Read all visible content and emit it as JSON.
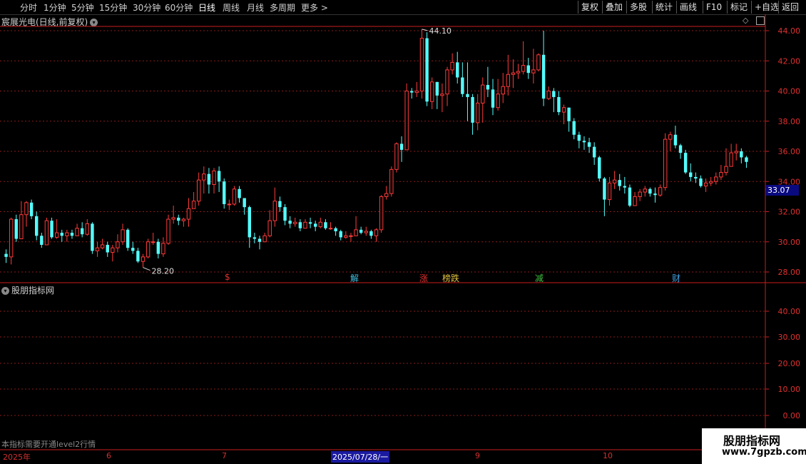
{
  "toolbar": {
    "periods": [
      "分时",
      "1分钟",
      "5分钟",
      "15分钟",
      "30分钟",
      "60分钟",
      "日线",
      "周线",
      "月线",
      "多周期",
      "更多 >"
    ],
    "active_period": "日线",
    "right_buttons": [
      "复权",
      "叠加",
      "多股",
      "统计",
      "画线",
      "F10",
      "标记",
      "+自选",
      "返回"
    ]
  },
  "main_chart": {
    "title": "宸展光电(日线,前复权)",
    "current_price": "33.07",
    "high_label": "44.10",
    "low_label": "28.20",
    "y_ticks": [
      "44.00",
      "42.00",
      "40.00",
      "38.00",
      "36.00",
      "34.00",
      "32.00",
      "30.00",
      "28.00"
    ],
    "events": [
      {
        "text": "$",
        "color": "#e03030"
      },
      {
        "text": "解",
        "color": "#40c0e0"
      },
      {
        "text": "涨",
        "color": "#e03030"
      },
      {
        "text": "榜跌",
        "color": "#e0c040"
      },
      {
        "text": "减",
        "color": "#40c040"
      },
      {
        "text": "财",
        "color": "#40a0e0"
      }
    ]
  },
  "indicator_panel": {
    "title": "股朋指标网",
    "y_ticks": [
      "40.00",
      "30.00",
      "20.00",
      "10.00",
      "0.00"
    ],
    "notice": "本指标需要开通level2行情"
  },
  "date_axis": {
    "labels": [
      "2025年",
      "6",
      "7",
      "2025/07/28/一",
      "9",
      "10"
    ]
  },
  "watermark": {
    "line1": "股朋指标网",
    "line2": "www.7gpzb.com"
  },
  "colors": {
    "up": "#ff3b3b",
    "down": "#54ffff",
    "axis": "#c81e1e",
    "grid": "#8a1a1a"
  },
  "chart_data": {
    "type": "candlestick",
    "ylim": [
      27.5,
      44.5
    ],
    "candles": [
      [
        29.2,
        29.0,
        29.5,
        28.6
      ],
      [
        29.0,
        31.5,
        31.6,
        28.5
      ],
      [
        31.5,
        30.2,
        31.8,
        30.0
      ],
      [
        30.2,
        31.8,
        32.7,
        30.2
      ],
      [
        31.8,
        32.6,
        32.7,
        31.0
      ],
      [
        32.6,
        31.7,
        32.8,
        31.5
      ],
      [
        31.7,
        30.4,
        32.0,
        30.1
      ],
      [
        30.4,
        29.8,
        30.6,
        29.6
      ],
      [
        29.8,
        31.4,
        31.6,
        29.8
      ],
      [
        31.4,
        30.3,
        31.6,
        30.2
      ],
      [
        30.3,
        30.6,
        31.5,
        30.2
      ],
      [
        30.6,
        30.4,
        30.8,
        30.0
      ],
      [
        30.4,
        30.6,
        30.8,
        30.0
      ],
      [
        30.6,
        30.4,
        30.8,
        30.2
      ],
      [
        30.4,
        30.9,
        31.2,
        30.4
      ],
      [
        30.9,
        30.5,
        31.3,
        30.3
      ],
      [
        30.5,
        31.2,
        31.5,
        30.4
      ],
      [
        31.2,
        29.4,
        31.3,
        29.2
      ],
      [
        29.4,
        29.6,
        30.0,
        29.0
      ],
      [
        29.6,
        29.8,
        30.2,
        29.5
      ],
      [
        29.8,
        29.3,
        30.0,
        29.0
      ],
      [
        29.3,
        29.6,
        29.8,
        28.7
      ],
      [
        29.6,
        30.0,
        30.5,
        29.3
      ],
      [
        30.0,
        30.8,
        31.2,
        29.8
      ],
      [
        30.8,
        29.6,
        30.9,
        29.4
      ],
      [
        29.6,
        29.4,
        30.0,
        29.2
      ],
      [
        29.4,
        28.7,
        29.6,
        28.6
      ],
      [
        28.7,
        29.0,
        29.2,
        28.3
      ],
      [
        29.0,
        30.0,
        30.2,
        28.9
      ],
      [
        30.0,
        30.0,
        30.6,
        29.8
      ],
      [
        30.0,
        29.2,
        30.2,
        28.9
      ],
      [
        29.2,
        29.9,
        30.3,
        29.0
      ],
      [
        29.9,
        31.5,
        31.8,
        29.8
      ],
      [
        31.5,
        31.6,
        32.4,
        31.2
      ],
      [
        31.6,
        31.4,
        31.8,
        31.1
      ],
      [
        31.4,
        31.5,
        31.6,
        31.0
      ],
      [
        31.5,
        32.2,
        32.9,
        31.0
      ],
      [
        32.2,
        32.7,
        33.3,
        32.2
      ],
      [
        32.7,
        34.1,
        34.6,
        32.4
      ],
      [
        34.1,
        34.5,
        35.0,
        33.2
      ],
      [
        34.5,
        33.8,
        34.9,
        33.2
      ],
      [
        33.8,
        34.7,
        34.9,
        33.2
      ],
      [
        34.7,
        34.0,
        35.0,
        33.3
      ],
      [
        34.0,
        32.5,
        34.2,
        32.2
      ],
      [
        32.5,
        32.5,
        32.8,
        32.1
      ],
      [
        32.5,
        33.5,
        33.7,
        32.4
      ],
      [
        33.5,
        32.9,
        33.7,
        32.6
      ],
      [
        32.9,
        32.3,
        32.9,
        31.8
      ],
      [
        32.3,
        30.3,
        32.4,
        29.6
      ],
      [
        30.3,
        30.2,
        30.6,
        29.9
      ],
      [
        30.2,
        30.0,
        30.4,
        29.5
      ],
      [
        30.0,
        30.4,
        30.6,
        30.0
      ],
      [
        30.4,
        31.4,
        32.1,
        30.3
      ],
      [
        31.4,
        32.7,
        33.6,
        31.0
      ],
      [
        32.7,
        32.3,
        33.0,
        32.0
      ],
      [
        32.3,
        31.4,
        32.5,
        31.1
      ],
      [
        31.4,
        31.2,
        31.7,
        30.9
      ],
      [
        31.2,
        31.3,
        31.6,
        31.0
      ],
      [
        31.3,
        30.9,
        31.5,
        30.7
      ],
      [
        30.9,
        31.3,
        31.5,
        30.9
      ],
      [
        31.3,
        31.2,
        31.6,
        30.9
      ],
      [
        31.2,
        31.0,
        31.4,
        30.7
      ],
      [
        31.0,
        31.3,
        31.6,
        30.9
      ],
      [
        31.3,
        30.9,
        31.5,
        30.8
      ],
      [
        30.9,
        30.9,
        31.3,
        30.8
      ],
      [
        30.9,
        30.7,
        31.0,
        30.4
      ],
      [
        30.7,
        30.3,
        30.8,
        30.1
      ],
      [
        30.3,
        30.4,
        30.7,
        30.2
      ],
      [
        30.4,
        30.4,
        30.6,
        30.0
      ],
      [
        30.4,
        30.8,
        31.7,
        30.4
      ],
      [
        30.8,
        30.6,
        31.0,
        30.5
      ],
      [
        30.6,
        30.7,
        31.0,
        30.4
      ],
      [
        30.7,
        30.4,
        30.8,
        30.2
      ],
      [
        30.4,
        30.8,
        30.9,
        30.0
      ],
      [
        30.8,
        33.0,
        33.1,
        30.6
      ],
      [
        33.0,
        33.2,
        33.7,
        32.8
      ],
      [
        33.2,
        34.8,
        35.0,
        33.0
      ],
      [
        34.8,
        36.5,
        36.6,
        34.6
      ],
      [
        36.5,
        36.1,
        37.0,
        35.3
      ],
      [
        36.1,
        40.0,
        40.5,
        37.1
      ],
      [
        40.0,
        39.9,
        40.2,
        39.5
      ],
      [
        39.9,
        40.0,
        40.6,
        39.6
      ],
      [
        40.0,
        43.5,
        44.1,
        39.5
      ],
      [
        43.5,
        39.3,
        43.9,
        39.0
      ],
      [
        39.3,
        40.6,
        40.9,
        38.8
      ],
      [
        40.6,
        39.7,
        40.6,
        38.8
      ],
      [
        39.7,
        39.8,
        40.5,
        38.6
      ],
      [
        39.8,
        41.4,
        41.6,
        39.0
      ],
      [
        41.4,
        41.9,
        42.5,
        41.1
      ],
      [
        41.9,
        40.9,
        42.6,
        40.5
      ],
      [
        40.9,
        39.8,
        41.9,
        39.6
      ],
      [
        39.8,
        39.6,
        41.9,
        38.0
      ],
      [
        39.6,
        37.9,
        39.8,
        37.1
      ],
      [
        37.9,
        39.2,
        39.8,
        37.4
      ],
      [
        39.2,
        40.4,
        40.9,
        37.9
      ],
      [
        40.4,
        40.1,
        41.6,
        39.6
      ],
      [
        40.1,
        38.9,
        40.8,
        38.4
      ],
      [
        38.9,
        39.8,
        40.8,
        38.7
      ],
      [
        39.8,
        40.3,
        41.2,
        39.2
      ],
      [
        40.3,
        41.1,
        42.4,
        39.7
      ],
      [
        41.1,
        41.2,
        42.1,
        40.2
      ],
      [
        41.2,
        41.3,
        41.8,
        40.8
      ],
      [
        41.3,
        41.7,
        43.3,
        41.1
      ],
      [
        41.7,
        41.2,
        42.2,
        40.8
      ],
      [
        41.2,
        41.4,
        42.8,
        40.5
      ],
      [
        41.4,
        42.4,
        42.5,
        41.3
      ],
      [
        42.4,
        39.5,
        44.0,
        39.0
      ],
      [
        39.5,
        40.0,
        40.3,
        39.4
      ],
      [
        40.0,
        39.6,
        40.2,
        38.6
      ],
      [
        39.6,
        38.6,
        40.0,
        38.4
      ],
      [
        38.6,
        38.9,
        39.1,
        37.8
      ],
      [
        38.9,
        38.0,
        38.9,
        37.3
      ],
      [
        38.0,
        37.1,
        38.2,
        36.8
      ],
      [
        37.1,
        36.7,
        37.3,
        36.2
      ],
      [
        36.7,
        36.6,
        37.0,
        36.1
      ],
      [
        36.6,
        36.3,
        36.9,
        35.9
      ],
      [
        36.3,
        35.6,
        36.6,
        35.1
      ],
      [
        35.6,
        34.2,
        35.7,
        34.0
      ],
      [
        34.2,
        32.8,
        34.3,
        31.7
      ],
      [
        32.8,
        33.9,
        34.3,
        32.4
      ],
      [
        33.9,
        34.1,
        34.7,
        33.5
      ],
      [
        34.1,
        33.7,
        34.5,
        33.4
      ],
      [
        33.7,
        33.6,
        34.3,
        33.2
      ],
      [
        33.6,
        32.4,
        33.8,
        32.3
      ],
      [
        32.4,
        33.0,
        33.3,
        32.4
      ],
      [
        33.0,
        33.3,
        33.5,
        32.7
      ],
      [
        33.3,
        33.5,
        33.7,
        33.0
      ],
      [
        33.5,
        33.2,
        33.6,
        33.0
      ],
      [
        33.2,
        33.1,
        33.6,
        32.6
      ],
      [
        33.1,
        33.6,
        33.8,
        33.0
      ],
      [
        33.6,
        36.8,
        37.2,
        33.4
      ],
      [
        36.8,
        37.1,
        37.3,
        36.0
      ],
      [
        37.1,
        36.4,
        37.7,
        36.2
      ],
      [
        36.4,
        35.9,
        36.5,
        35.5
      ],
      [
        35.9,
        34.6,
        36.1,
        34.5
      ],
      [
        34.6,
        34.3,
        35.2,
        34.0
      ],
      [
        34.3,
        34.2,
        34.6,
        33.9
      ],
      [
        34.2,
        33.7,
        34.4,
        33.6
      ],
      [
        33.7,
        33.9,
        34.2,
        33.3
      ],
      [
        33.9,
        34.0,
        34.3,
        33.7
      ],
      [
        34.0,
        34.3,
        34.6,
        33.8
      ],
      [
        34.3,
        34.6,
        35.1,
        34.1
      ],
      [
        34.6,
        35.0,
        36.2,
        34.4
      ],
      [
        35.0,
        35.9,
        36.5,
        35.6
      ],
      [
        35.9,
        36.0,
        36.5,
        35.4
      ],
      [
        36.0,
        35.6,
        36.2,
        35.2
      ],
      [
        35.6,
        35.3,
        35.7,
        34.9
      ]
    ]
  }
}
